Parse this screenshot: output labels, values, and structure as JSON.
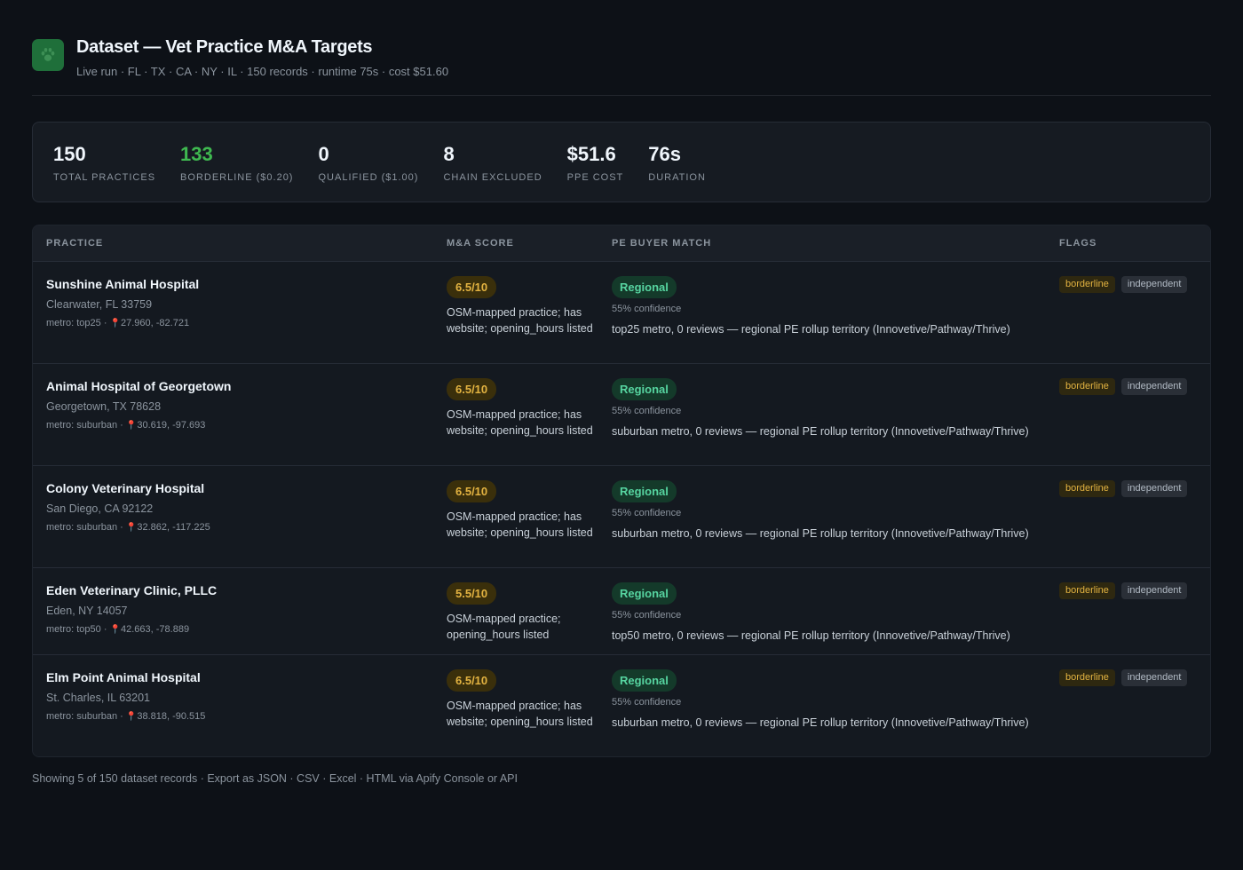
{
  "header": {
    "title": "Dataset — Vet Practice M&A Targets",
    "subtitle": "Live run · FL · TX · CA · NY · IL · 150 records · runtime 75s · cost $51.60",
    "logo_icon": "paw-icon"
  },
  "stats": [
    {
      "value": "150",
      "label": "Total practices",
      "color": "#f0f6fc"
    },
    {
      "value": "133",
      "label": "Borderline ($0.20)",
      "color": "#3fb950"
    },
    {
      "value": "0",
      "label": "Qualified ($1.00)",
      "color": "#f0f6fc"
    },
    {
      "value": "8",
      "label": "Chain excluded",
      "color": "#f0f6fc"
    },
    {
      "value": "$51.6",
      "label": "PPE cost",
      "color": "#f0f6fc"
    },
    {
      "value": "76s",
      "label": "Duration",
      "color": "#f0f6fc"
    }
  ],
  "table": {
    "headers": [
      "Practice",
      "M&A Score",
      "PE Buyer Match",
      "Flags"
    ],
    "rows": [
      {
        "name": "Sunshine Animal Hospital",
        "address": "Clearwater, FL 33759",
        "metro": "metro: top25 ·",
        "coords": "27.960, -82.721",
        "score": "6.5/10",
        "score_note": "OSM-mapped practice; has website; opening_hours listed",
        "buyer": "Regional",
        "confidence": "55% confidence",
        "buyer_note": "top25 metro, 0 reviews — regional PE rollup territory (Innovetive/Pathway/Thrive)",
        "flags": [
          "borderline",
          "independent"
        ]
      },
      {
        "name": "Animal Hospital of Georgetown",
        "address": "Georgetown, TX 78628",
        "metro": "metro: suburban ·",
        "coords": "30.619, -97.693",
        "score": "6.5/10",
        "score_note": "OSM-mapped practice; has website; opening_hours listed",
        "buyer": "Regional",
        "confidence": "55% confidence",
        "buyer_note": "suburban metro, 0 reviews — regional PE rollup territory (Innovetive/Pathway/Thrive)",
        "flags": [
          "borderline",
          "independent"
        ]
      },
      {
        "name": "Colony Veterinary Hospital",
        "address": "San Diego, CA 92122",
        "metro": "metro: suburban ·",
        "coords": "32.862, -117.225",
        "score": "6.5/10",
        "score_note": "OSM-mapped practice; has website; opening_hours listed",
        "buyer": "Regional",
        "confidence": "55% confidence",
        "buyer_note": "suburban metro, 0 reviews — regional PE rollup territory (Innovetive/Pathway/Thrive)",
        "flags": [
          "borderline",
          "independent"
        ]
      },
      {
        "name": "Eden Veterinary Clinic, PLLC",
        "address": "Eden, NY 14057",
        "metro": "metro: top50 ·",
        "coords": "42.663, -78.889",
        "score": "5.5/10",
        "score_note": "OSM-mapped practice; opening_hours listed",
        "buyer": "Regional",
        "confidence": "55% confidence",
        "buyer_note": "top50 metro, 0 reviews — regional PE rollup territory (Innovetive/Pathway/Thrive)",
        "flags": [
          "borderline",
          "independent"
        ]
      },
      {
        "name": "Elm Point Animal Hospital",
        "address": "St. Charles, IL 63201",
        "metro": "metro: suburban ·",
        "coords": "38.818, -90.515",
        "score": "6.5/10",
        "score_note": "OSM-mapped practice; has website; opening_hours listed",
        "buyer": "Regional",
        "confidence": "55% confidence",
        "buyer_note": "suburban metro, 0 reviews — regional PE rollup territory (Innovetive/Pathway/Thrive)",
        "flags": [
          "borderline",
          "independent"
        ]
      }
    ]
  },
  "footer": "Showing 5 of 150 dataset records · Export as JSON · CSV · Excel · HTML via Apify Console or API"
}
